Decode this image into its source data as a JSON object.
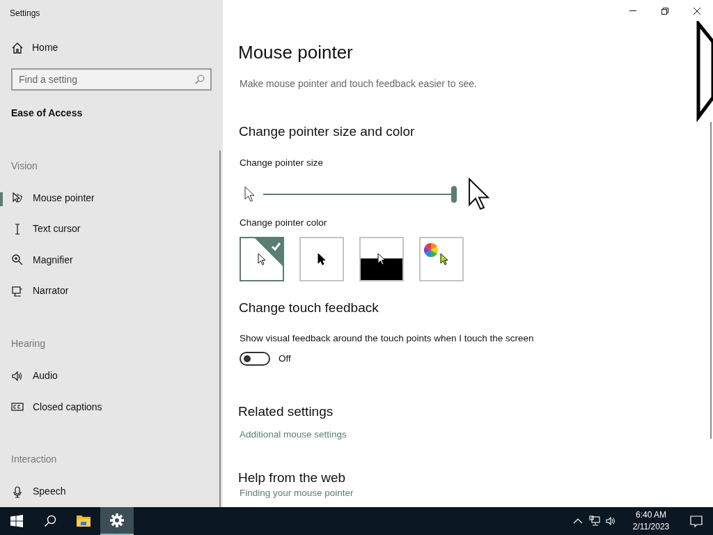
{
  "window": {
    "title": "Settings"
  },
  "sidebar": {
    "home": "Home",
    "search": {
      "placeholder": "Find a setting"
    },
    "section": "Ease of Access",
    "groups": [
      {
        "heading": "Vision",
        "items": [
          {
            "label": "Mouse pointer",
            "selected": true
          },
          {
            "label": "Text cursor",
            "selected": false
          },
          {
            "label": "Magnifier",
            "selected": false
          },
          {
            "label": "Narrator",
            "selected": false
          }
        ]
      },
      {
        "heading": "Hearing",
        "items": [
          {
            "label": "Audio",
            "selected": false
          },
          {
            "label": "Closed captions",
            "selected": false
          }
        ]
      },
      {
        "heading": "Interaction",
        "items": [
          {
            "label": "Speech",
            "selected": false
          }
        ]
      }
    ]
  },
  "main": {
    "title": "Mouse pointer",
    "description": "Make mouse pointer and touch feedback easier to see.",
    "size_section": {
      "heading": "Change pointer size and color",
      "size_label": "Change pointer size",
      "size": {
        "level": 1.0
      },
      "color_label": "Change pointer color",
      "colors": [
        {
          "kind": "white",
          "selected": true
        },
        {
          "kind": "black",
          "selected": false
        },
        {
          "kind": "inverted",
          "selected": false
        },
        {
          "kind": "custom",
          "selected": false
        }
      ]
    },
    "touch_section": {
      "heading": "Change touch feedback",
      "label": "Show visual feedback around the touch points when I touch the screen",
      "toggle": {
        "on": false,
        "state_label": "Off"
      }
    },
    "related": {
      "heading": "Related settings",
      "links": [
        "Additional mouse settings"
      ]
    },
    "help": {
      "heading": "Help from the web",
      "links": [
        "Finding your mouse pointer"
      ]
    }
  },
  "taskbar": {
    "apps": [
      {
        "kind": "start",
        "selected": false
      },
      {
        "kind": "search",
        "selected": false
      },
      {
        "kind": "explorer",
        "selected": false
      },
      {
        "kind": "settings",
        "selected": true
      }
    ],
    "time": "6:40 AM",
    "date": "2/11/2023"
  }
}
